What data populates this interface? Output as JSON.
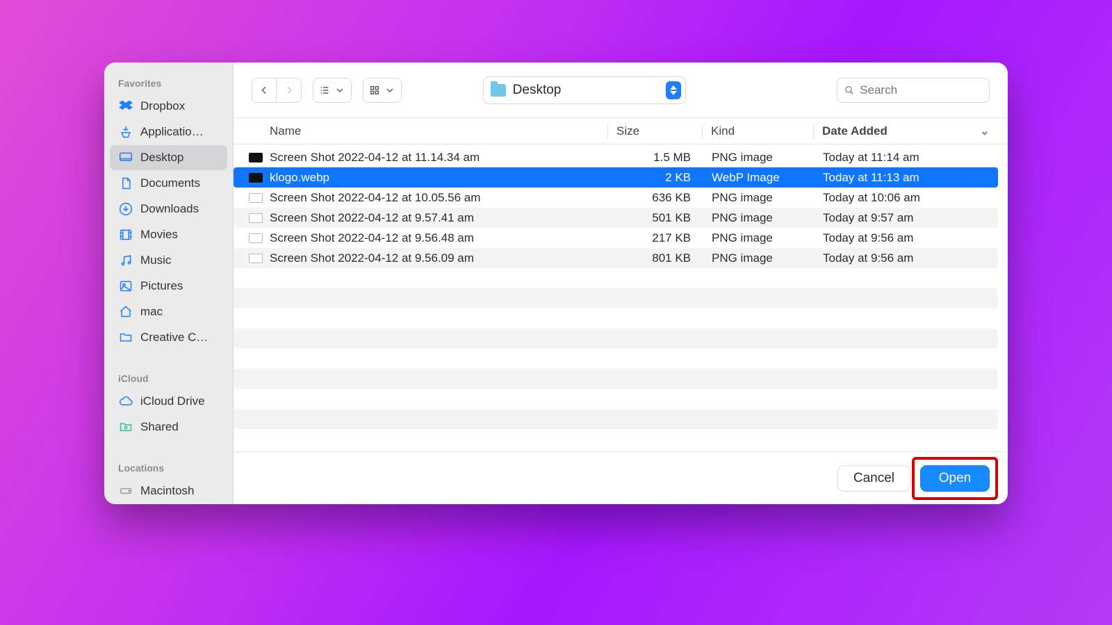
{
  "sidebar": {
    "sections": {
      "favorites_label": "Favorites",
      "icloud_label": "iCloud",
      "locations_label": "Locations"
    },
    "favorites": [
      {
        "id": "dropbox",
        "label": "Dropbox"
      },
      {
        "id": "applications",
        "label": "Applicatio…"
      },
      {
        "id": "desktop",
        "label": "Desktop",
        "active": true
      },
      {
        "id": "documents",
        "label": "Documents"
      },
      {
        "id": "downloads",
        "label": "Downloads"
      },
      {
        "id": "movies",
        "label": "Movies"
      },
      {
        "id": "music",
        "label": "Music"
      },
      {
        "id": "pictures",
        "label": "Pictures"
      },
      {
        "id": "home",
        "label": "mac"
      },
      {
        "id": "creative",
        "label": "Creative C…"
      }
    ],
    "icloud": [
      {
        "id": "icloud-drive",
        "label": "iCloud Drive"
      },
      {
        "id": "shared",
        "label": "Shared"
      }
    ],
    "locations": [
      {
        "id": "macintosh",
        "label": "Macintosh"
      }
    ]
  },
  "toolbar": {
    "current_folder": "Desktop",
    "search_placeholder": "Search"
  },
  "columns": {
    "name": "Name",
    "size": "Size",
    "kind": "Kind",
    "date": "Date Added"
  },
  "files": [
    {
      "name": "Screen Shot 2022-04-12 at 11.14.34 am",
      "size": "1.5 MB",
      "kind": "PNG image",
      "date": "Today at 11:14 am",
      "selected": false,
      "icon": "dark"
    },
    {
      "name": "klogo.webp",
      "size": "2 KB",
      "kind": "WebP Image",
      "date": "Today at 11:13 am",
      "selected": true,
      "icon": "dark"
    },
    {
      "name": "Screen Shot 2022-04-12 at 10.05.56 am",
      "size": "636 KB",
      "kind": "PNG image",
      "date": "Today at 10:06 am",
      "selected": false,
      "icon": "light"
    },
    {
      "name": "Screen Shot 2022-04-12 at 9.57.41 am",
      "size": "501 KB",
      "kind": "PNG image",
      "date": "Today at 9:57 am",
      "selected": false,
      "icon": "light"
    },
    {
      "name": "Screen Shot 2022-04-12 at 9.56.48 am",
      "size": "217 KB",
      "kind": "PNG image",
      "date": "Today at 9:56 am",
      "selected": false,
      "icon": "light"
    },
    {
      "name": "Screen Shot 2022-04-12 at 9.56.09 am",
      "size": "801 KB",
      "kind": "PNG image",
      "date": "Today at 9:56 am",
      "selected": false,
      "icon": "light"
    }
  ],
  "footer": {
    "cancel": "Cancel",
    "open": "Open"
  }
}
